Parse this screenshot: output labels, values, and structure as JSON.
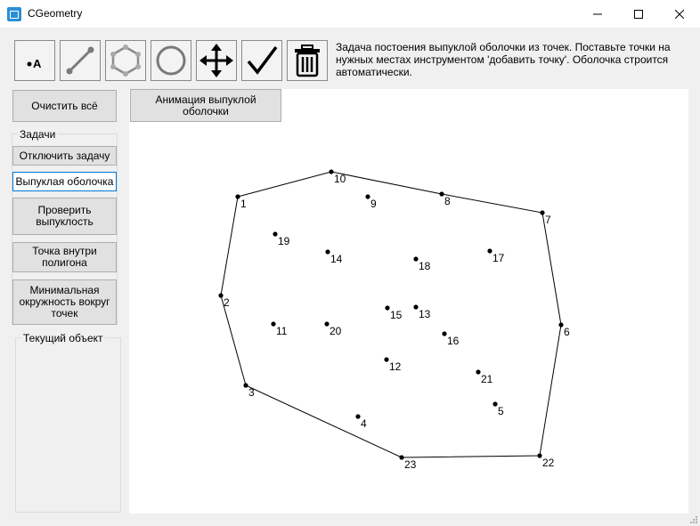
{
  "window": {
    "title": "CGeometry"
  },
  "toolbar": {
    "tools": [
      {
        "name": "add-point-tool",
        "icon": "point-label-icon",
        "label": "A"
      },
      {
        "name": "segment-tool",
        "icon": "segment-icon"
      },
      {
        "name": "polygon-tool",
        "icon": "polygon-icon"
      },
      {
        "name": "circle-tool",
        "icon": "circle-icon"
      },
      {
        "name": "move-tool",
        "icon": "move-arrows-icon"
      },
      {
        "name": "check-tool",
        "icon": "checkmark-icon"
      },
      {
        "name": "delete-tool",
        "icon": "trash-icon"
      }
    ],
    "description": "Задача постоения выпуклой оболочки из точек. Поставьте точки на нужных местах инструментом 'добавить точку'. Оболочка строится автоматически."
  },
  "left_panel": {
    "clear_all": "Очистить всё",
    "tasks_group": "Задачи",
    "disable_task": "Отключить задачу",
    "convex_hull": "Выпуклая оболочка",
    "check_convexity": "Проверить выпуклость",
    "point_in_polygon": "Точка внутри полигона",
    "min_enclosing_circle": "Минимальная окружность вокруг точек",
    "current_object_group": "Текущий объект"
  },
  "canvas": {
    "animate_button": "Анимация выпуклой оболочки",
    "points": [
      {
        "label": "1"
      },
      {
        "label": "2"
      },
      {
        "label": "3"
      },
      {
        "label": "4"
      },
      {
        "label": "5"
      },
      {
        "label": "6"
      },
      {
        "label": "7"
      },
      {
        "label": "8"
      },
      {
        "label": "9"
      },
      {
        "label": "10"
      },
      {
        "label": "11"
      },
      {
        "label": "12"
      },
      {
        "label": "13"
      },
      {
        "label": "14"
      },
      {
        "label": "15"
      },
      {
        "label": "16"
      },
      {
        "label": "17"
      },
      {
        "label": "18"
      },
      {
        "label": "19"
      },
      {
        "label": "20"
      },
      {
        "label": "21"
      },
      {
        "label": "22"
      },
      {
        "label": "23"
      }
    ],
    "hull_order": [
      "1",
      "10",
      "8",
      "7",
      "6",
      "22",
      "23",
      "3",
      "2"
    ]
  }
}
